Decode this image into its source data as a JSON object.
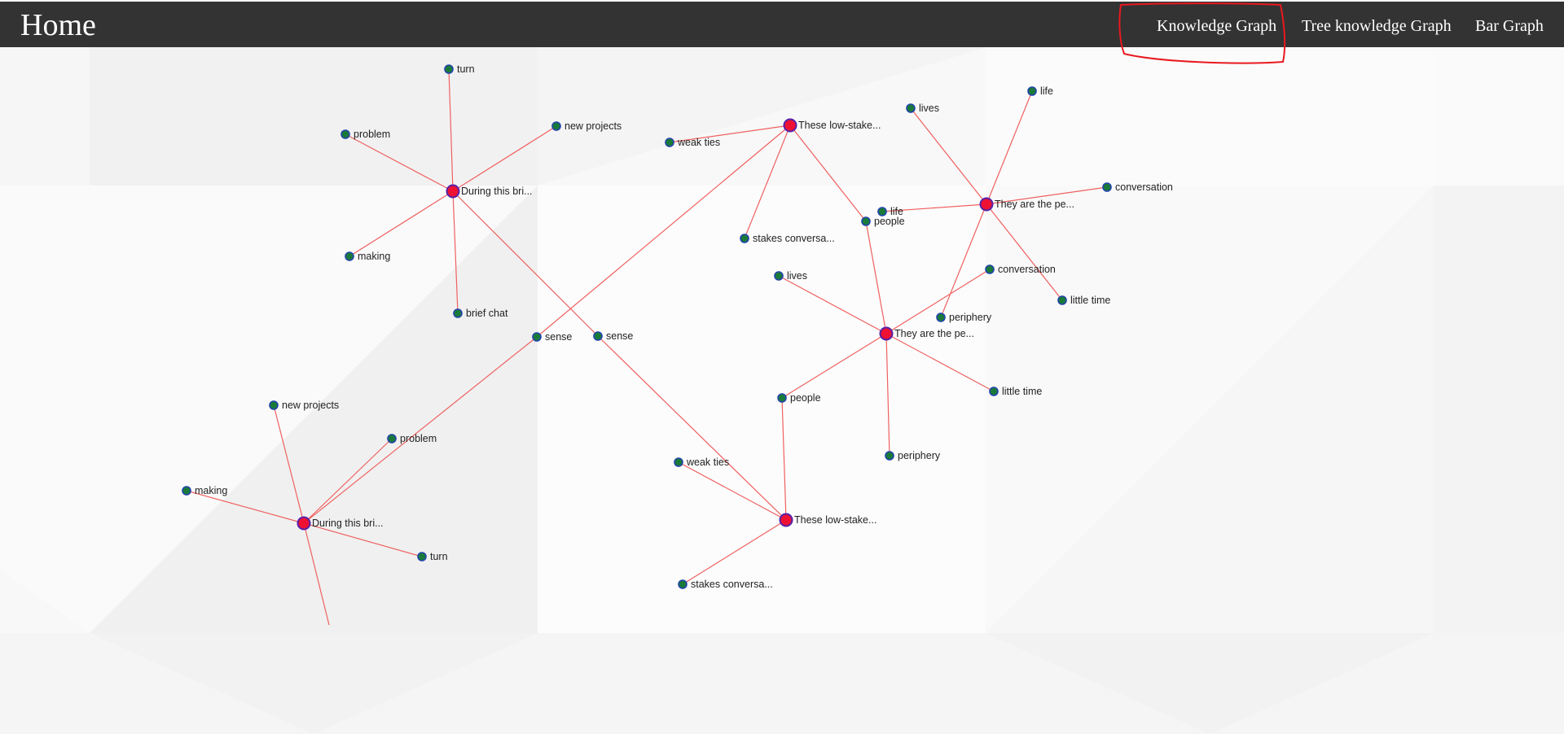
{
  "navbar": {
    "brand": "Home",
    "links": [
      "Knowledge Graph",
      "Tree knowledge Graph",
      "Bar Graph"
    ],
    "highlighted": "Knowledge Graph"
  },
  "colors": {
    "navbar_bg": "#333333",
    "nav_text": "#ffffff",
    "edge": "#f06060",
    "main_node_fill": "#ee1133",
    "main_node_stroke": "#5522aa",
    "leaf_node_fill": "#1a7a3a",
    "leaf_node_stroke": "#2244aa",
    "highlight": "#e8191f"
  },
  "graph": {
    "nodes": [
      {
        "id": "A1",
        "label": "During this bri...",
        "type": "main"
      },
      {
        "id": "A1_turn",
        "label": "turn",
        "type": "leaf"
      },
      {
        "id": "A1_problem",
        "label": "problem",
        "type": "leaf"
      },
      {
        "id": "A1_newprojects",
        "label": "new projects",
        "type": "leaf"
      },
      {
        "id": "A1_making",
        "label": "making",
        "type": "leaf"
      },
      {
        "id": "A1_briefchat",
        "label": "brief chat",
        "type": "leaf"
      },
      {
        "id": "sense2",
        "label": "sense",
        "type": "leaf"
      },
      {
        "id": "B1",
        "label": "These low-stake...",
        "type": "main"
      },
      {
        "id": "B1_weakties",
        "label": "weak ties",
        "type": "leaf"
      },
      {
        "id": "B1_stakes",
        "label": "stakes conversa...",
        "type": "leaf"
      },
      {
        "id": "B1_people",
        "label": "people",
        "type": "leaf"
      },
      {
        "id": "sense1",
        "label": "sense",
        "type": "leaf"
      },
      {
        "id": "C1",
        "label": "They are the pe...",
        "type": "main"
      },
      {
        "id": "C1_lives",
        "label": "lives",
        "type": "leaf"
      },
      {
        "id": "C1_life",
        "label": "life",
        "type": "leaf"
      },
      {
        "id": "C1_conversation",
        "label": "conversation",
        "type": "leaf"
      },
      {
        "id": "C1_life2",
        "label": "life",
        "type": "leaf"
      },
      {
        "id": "C1_littletime",
        "label": "little time",
        "type": "leaf"
      },
      {
        "id": "C1_periphery",
        "label": "periphery",
        "type": "leaf"
      },
      {
        "id": "C2",
        "label": "They are the pe...",
        "type": "main"
      },
      {
        "id": "C2_lives",
        "label": "lives",
        "type": "leaf"
      },
      {
        "id": "C2_conversation",
        "label": "conversation",
        "type": "leaf"
      },
      {
        "id": "C2_littletime",
        "label": "little time",
        "type": "leaf"
      },
      {
        "id": "C2_periphery",
        "label": "periphery",
        "type": "leaf"
      },
      {
        "id": "C2_people",
        "label": "people",
        "type": "leaf"
      },
      {
        "id": "B2",
        "label": "These low-stake...",
        "type": "main"
      },
      {
        "id": "B2_weakties",
        "label": "weak ties",
        "type": "leaf"
      },
      {
        "id": "B2_stakes",
        "label": "stakes conversa...",
        "type": "leaf"
      },
      {
        "id": "A2",
        "label": "During this bri...",
        "type": "main"
      },
      {
        "id": "A2_newprojects",
        "label": "new projects",
        "type": "leaf"
      },
      {
        "id": "A2_problem",
        "label": "problem",
        "type": "leaf"
      },
      {
        "id": "A2_making",
        "label": "making",
        "type": "leaf"
      },
      {
        "id": "A2_turn",
        "label": "turn",
        "type": "leaf"
      }
    ],
    "edges": [
      [
        "A1",
        "A1_turn"
      ],
      [
        "A1",
        "A1_problem"
      ],
      [
        "A1",
        "A1_newprojects"
      ],
      [
        "A1",
        "A1_making"
      ],
      [
        "A1",
        "A1_briefchat"
      ],
      [
        "A1",
        "sense2"
      ],
      [
        "sense2",
        "B2"
      ],
      [
        "B1",
        "B1_weakties"
      ],
      [
        "B1",
        "B1_stakes"
      ],
      [
        "B1",
        "B1_people"
      ],
      [
        "B1",
        "sense1"
      ],
      [
        "sense1",
        "A2"
      ],
      [
        "C1",
        "C1_lives"
      ],
      [
        "C1",
        "C1_life"
      ],
      [
        "C1",
        "C1_conversation"
      ],
      [
        "C1",
        "C1_life2"
      ],
      [
        "C1",
        "C1_littletime"
      ],
      [
        "C1",
        "C1_periphery"
      ],
      [
        "C2",
        "C2_lives"
      ],
      [
        "C2",
        "C2_conversation"
      ],
      [
        "C2",
        "C2_littletime"
      ],
      [
        "C2",
        "C2_periphery"
      ],
      [
        "C2",
        "C2_people"
      ],
      [
        "C2",
        "B1_people"
      ],
      [
        "B2",
        "B2_weakties"
      ],
      [
        "B2",
        "B2_stakes"
      ],
      [
        "B2",
        "C2_people"
      ],
      [
        "A2",
        "A2_newprojects"
      ],
      [
        "A2",
        "A2_problem"
      ],
      [
        "A2",
        "A2_making"
      ],
      [
        "A2",
        "A2_turn"
      ],
      [
        "A2",
        "A2_offscreen"
      ]
    ]
  }
}
